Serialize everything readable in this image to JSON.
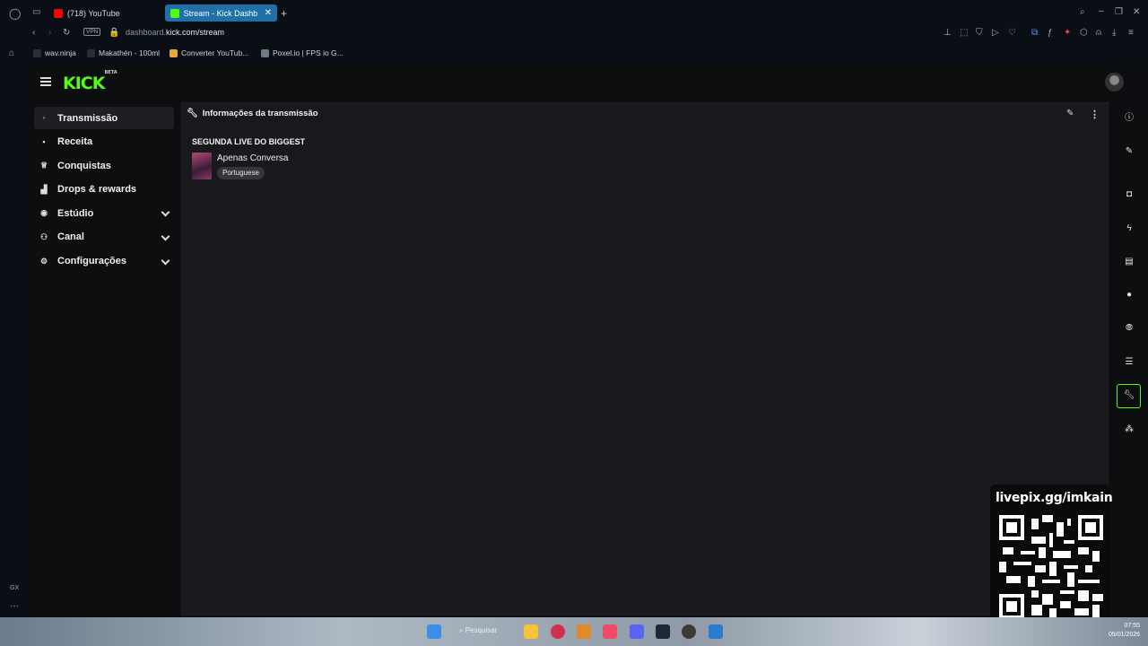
{
  "browser": {
    "tabs": [
      {
        "label": "(718) YouTube",
        "color": "#ff0000"
      },
      {
        "label": "Stream - Kick Dashbo...",
        "color": "#53fc18",
        "active": true
      }
    ],
    "url_prefix": "dashboard.",
    "url_main": "kick.com/stream",
    "vpn_label": "VPN",
    "bookmarks": [
      "wav.ninja",
      "Makathén - 100ml",
      "Converter YouTub...",
      "Poxel.io | FPS io G..."
    ],
    "gx_label": "GX"
  },
  "kick": {
    "logo": "KICK",
    "logo_badge": "BETA",
    "brand_color": "#53fc18",
    "nav": [
      {
        "label": "Transmissão",
        "icon": "broadcast-icon",
        "glyph": "(·)"
      },
      {
        "label": "Receita",
        "icon": "revenue-icon",
        "glyph": "■"
      },
      {
        "label": "Conquistas",
        "icon": "trophy-icon",
        "glyph": "🏆"
      },
      {
        "label": "Drops & rewards",
        "icon": "drops-icon",
        "glyph": "▟"
      },
      {
        "label": "Estúdio",
        "icon": "studio-icon",
        "glyph": "◉"
      },
      {
        "label": "Canal",
        "icon": "channel-icon",
        "glyph": "⚇"
      },
      {
        "label": "Configurações",
        "icon": "settings-icon",
        "glyph": "⚙"
      }
    ],
    "panel": {
      "title": "Informações da transmissão",
      "stream_title": "SEGUNDA LIVE DO BIGGEST",
      "category": "Apenas Conversa",
      "language": "Portuguese"
    }
  },
  "overlay": {
    "qr_label": "livepix.gg/imkain"
  },
  "taskbar": {
    "search_label": "Pesquisar",
    "time": "07:55",
    "date": "05/01/2026"
  }
}
